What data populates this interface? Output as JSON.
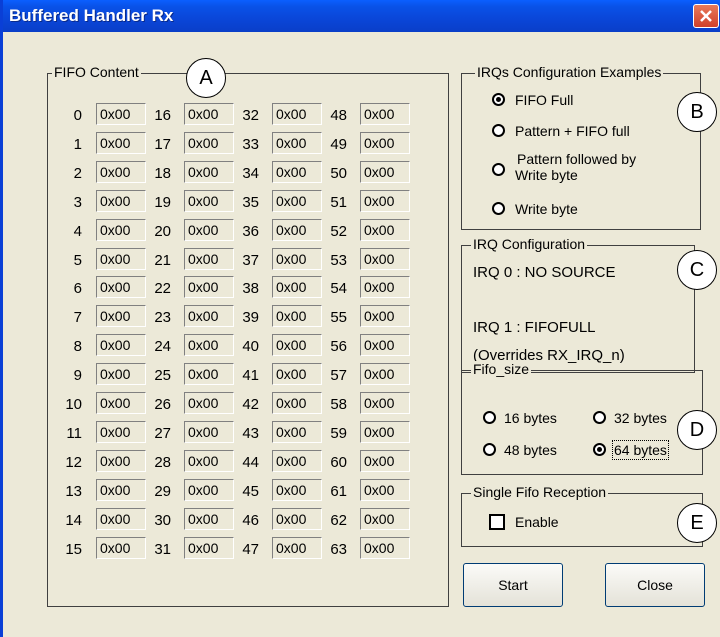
{
  "window": {
    "title": "Buffered Handler Rx"
  },
  "fifo": {
    "label": "FIFO Content",
    "cells": [
      {
        "index": "0",
        "value": "0x00"
      },
      {
        "index": "1",
        "value": "0x00"
      },
      {
        "index": "2",
        "value": "0x00"
      },
      {
        "index": "3",
        "value": "0x00"
      },
      {
        "index": "4",
        "value": "0x00"
      },
      {
        "index": "5",
        "value": "0x00"
      },
      {
        "index": "6",
        "value": "0x00"
      },
      {
        "index": "7",
        "value": "0x00"
      },
      {
        "index": "8",
        "value": "0x00"
      },
      {
        "index": "9",
        "value": "0x00"
      },
      {
        "index": "10",
        "value": "0x00"
      },
      {
        "index": "11",
        "value": "0x00"
      },
      {
        "index": "12",
        "value": "0x00"
      },
      {
        "index": "13",
        "value": "0x00"
      },
      {
        "index": "14",
        "value": "0x00"
      },
      {
        "index": "15",
        "value": "0x00"
      },
      {
        "index": "16",
        "value": "0x00"
      },
      {
        "index": "17",
        "value": "0x00"
      },
      {
        "index": "18",
        "value": "0x00"
      },
      {
        "index": "19",
        "value": "0x00"
      },
      {
        "index": "20",
        "value": "0x00"
      },
      {
        "index": "21",
        "value": "0x00"
      },
      {
        "index": "22",
        "value": "0x00"
      },
      {
        "index": "23",
        "value": "0x00"
      },
      {
        "index": "24",
        "value": "0x00"
      },
      {
        "index": "25",
        "value": "0x00"
      },
      {
        "index": "26",
        "value": "0x00"
      },
      {
        "index": "27",
        "value": "0x00"
      },
      {
        "index": "28",
        "value": "0x00"
      },
      {
        "index": "29",
        "value": "0x00"
      },
      {
        "index": "30",
        "value": "0x00"
      },
      {
        "index": "31",
        "value": "0x00"
      },
      {
        "index": "32",
        "value": "0x00"
      },
      {
        "index": "33",
        "value": "0x00"
      },
      {
        "index": "34",
        "value": "0x00"
      },
      {
        "index": "35",
        "value": "0x00"
      },
      {
        "index": "36",
        "value": "0x00"
      },
      {
        "index": "37",
        "value": "0x00"
      },
      {
        "index": "38",
        "value": "0x00"
      },
      {
        "index": "39",
        "value": "0x00"
      },
      {
        "index": "40",
        "value": "0x00"
      },
      {
        "index": "41",
        "value": "0x00"
      },
      {
        "index": "42",
        "value": "0x00"
      },
      {
        "index": "43",
        "value": "0x00"
      },
      {
        "index": "44",
        "value": "0x00"
      },
      {
        "index": "45",
        "value": "0x00"
      },
      {
        "index": "46",
        "value": "0x00"
      },
      {
        "index": "47",
        "value": "0x00"
      },
      {
        "index": "48",
        "value": "0x00"
      },
      {
        "index": "49",
        "value": "0x00"
      },
      {
        "index": "50",
        "value": "0x00"
      },
      {
        "index": "51",
        "value": "0x00"
      },
      {
        "index": "52",
        "value": "0x00"
      },
      {
        "index": "53",
        "value": "0x00"
      },
      {
        "index": "54",
        "value": "0x00"
      },
      {
        "index": "55",
        "value": "0x00"
      },
      {
        "index": "56",
        "value": "0x00"
      },
      {
        "index": "57",
        "value": "0x00"
      },
      {
        "index": "58",
        "value": "0x00"
      },
      {
        "index": "59",
        "value": "0x00"
      },
      {
        "index": "60",
        "value": "0x00"
      },
      {
        "index": "61",
        "value": "0x00"
      },
      {
        "index": "62",
        "value": "0x00"
      },
      {
        "index": "63",
        "value": "0x00"
      }
    ]
  },
  "irq_examples": {
    "label": "IRQs Configuration Examples",
    "options": [
      {
        "label": "FIFO Full",
        "checked": true
      },
      {
        "label": "Pattern + FIFO full",
        "checked": false
      },
      {
        "label_line1": "Pattern followed by",
        "label_line2": "Write byte",
        "checked": false
      },
      {
        "label": "Write byte",
        "checked": false
      }
    ]
  },
  "irq_config": {
    "label": "IRQ Configuration",
    "irq0": "IRQ 0 :  NO SOURCE",
    "irq1": "IRQ 1 :  FIFOFULL",
    "note": "(Overrides RX_IRQ_n)"
  },
  "fifo_size": {
    "label": "Fifo_size",
    "options": [
      {
        "label": "16 bytes",
        "checked": false
      },
      {
        "label": "32 bytes",
        "checked": false
      },
      {
        "label": "48 bytes",
        "checked": false
      },
      {
        "label": "64 bytes",
        "checked": true
      }
    ]
  },
  "single_fifo": {
    "label": "Single Fifo Reception",
    "checkbox_label": "Enable",
    "checked": false
  },
  "buttons": {
    "start": "Start",
    "close": "Close"
  },
  "callouts": [
    "A",
    "B",
    "C",
    "D",
    "E"
  ],
  "colors": {
    "titlebar": "#0a46d8",
    "window_bg": "#ece9d8",
    "close_button": "#d0402a"
  }
}
